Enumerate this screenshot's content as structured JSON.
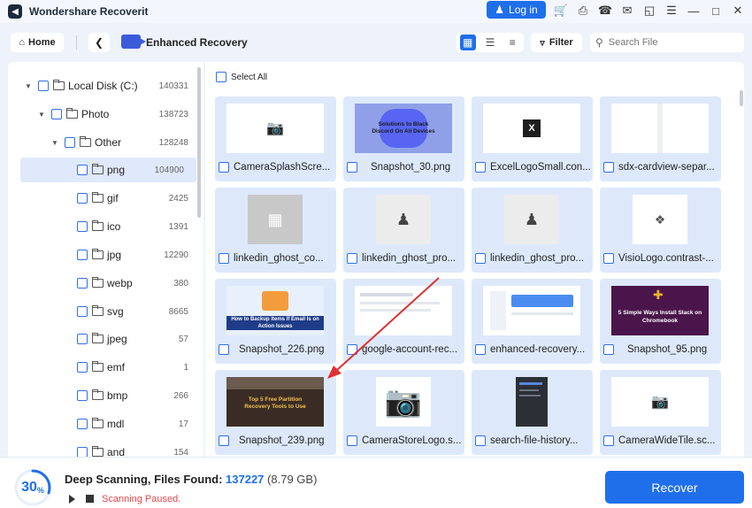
{
  "app": {
    "title": "Wondershare Recoverit"
  },
  "titlebar": {
    "login_label": "Log in"
  },
  "toolbar": {
    "home_label": "Home",
    "section_title": "Enhanced Recovery",
    "filter_label": "Filter",
    "search_placeholder": "Search File"
  },
  "sidebar": {
    "items": [
      {
        "label": "Local Disk (C:)",
        "count": "140331"
      },
      {
        "label": "Photo",
        "count": "138723"
      },
      {
        "label": "Other",
        "count": "128248"
      },
      {
        "label": "png",
        "count": "104900"
      },
      {
        "label": "gif",
        "count": "2425"
      },
      {
        "label": "ico",
        "count": "1391"
      },
      {
        "label": "jpg",
        "count": "12290"
      },
      {
        "label": "webp",
        "count": "380"
      },
      {
        "label": "svg",
        "count": "8665"
      },
      {
        "label": "jpeg",
        "count": "57"
      },
      {
        "label": "emf",
        "count": "1"
      },
      {
        "label": "bmp",
        "count": "266"
      },
      {
        "label": "mdl",
        "count": "17"
      },
      {
        "label": "and",
        "count": "154"
      }
    ]
  },
  "main": {
    "select_all_label": "Select All",
    "files": [
      {
        "name": "CameraSplashScre..."
      },
      {
        "name": "Snapshot_30.png",
        "thumb_text": "Solutions to Black Discord On All Devices"
      },
      {
        "name": "ExcelLogoSmall.con..."
      },
      {
        "name": "sdx-cardview-separ..."
      },
      {
        "name": "linkedin_ghost_co..."
      },
      {
        "name": "linkedin_ghost_pro..."
      },
      {
        "name": "linkedin_ghost_pro..."
      },
      {
        "name": "VisioLogo.contrast-..."
      },
      {
        "name": "Snapshot_226.png",
        "thumb_text": "How to Backup Items If Email Is on Action Issues"
      },
      {
        "name": "google-account-rec..."
      },
      {
        "name": "enhanced-recovery..."
      },
      {
        "name": "Snapshot_95.png",
        "thumb_text": "5 Simple Ways Install Slack on Chromebook"
      },
      {
        "name": "Snapshot_239.png",
        "thumb_text": "Top 5 Free Partition Recovery Tools to Use"
      },
      {
        "name": "CameraStoreLogo.s..."
      },
      {
        "name": "search-file-history..."
      },
      {
        "name": "CameraWideTile.sc..."
      }
    ]
  },
  "status": {
    "progress_value": "30",
    "progress_unit": "%",
    "progress_fraction": 0.3,
    "scan_label": "Deep Scanning, Files Found:",
    "files_found": "137227",
    "size": "(8.79 GB)",
    "state_text": "Scanning Paused."
  },
  "actions": {
    "recover_label": "Recover"
  },
  "colors": {
    "accent": "#1f6feb",
    "warning": "#e5484d",
    "cart": "#ff6a1a"
  }
}
